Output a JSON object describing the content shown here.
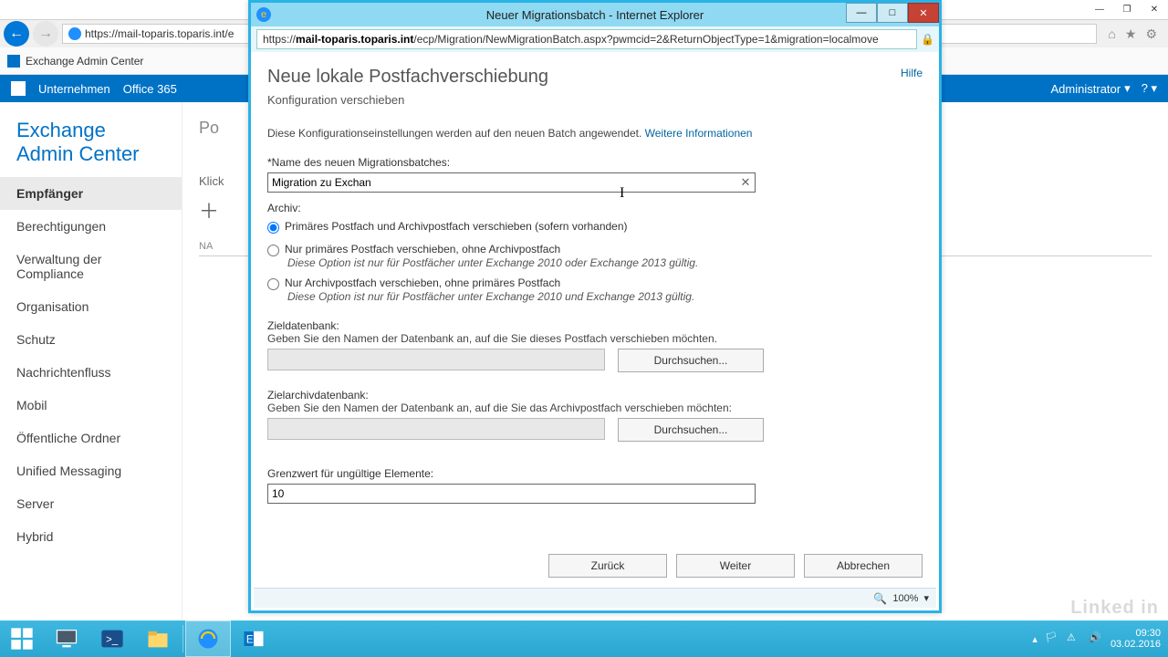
{
  "main_window": {
    "url": "https://mail-toparis.toparis.int/e",
    "tab_title": "Exchange Admin Center",
    "o365": {
      "company": "Unternehmen",
      "office": "Office 365",
      "admin": "Administrator",
      "help": "?"
    },
    "eac_title": "Exchange Admin Center",
    "nav": [
      "Empfänger",
      "Berechtigungen",
      "Verwaltung der Compliance",
      "Organisation",
      "Schutz",
      "Nachrichtenfluss",
      "Mobil",
      "Öffentliche Ordner",
      "Unified Messaging",
      "Server",
      "Hybrid"
    ],
    "content": {
      "heading_partial": "Po",
      "klick_partial": "Klick",
      "nah_partial": "NA"
    }
  },
  "popup": {
    "title": "Neuer Migrationsbatch - Internet Explorer",
    "url_prefix": "https://",
    "url_host": "mail-toparis.toparis.int",
    "url_path": "/ecp/Migration/NewMigrationBatch.aspx?pwmcid=2&ReturnObjectType=1&migration=localmove",
    "help": "Hilfe",
    "h1": "Neue lokale Postfachverschiebung",
    "h2": "Konfiguration verschieben",
    "desc": "Diese Konfigurationseinstellungen werden auf den neuen Batch angewendet.",
    "more_info": "Weitere Informationen",
    "name_label": "*Name des neuen Migrationsbatches:",
    "name_value": "Migration zu Exchan",
    "archive_label": "Archiv:",
    "radios": {
      "r1": "Primäres Postfach und Archivpostfach verschieben (sofern vorhanden)",
      "r2": "Nur primäres Postfach verschieben, ohne Archivpostfach",
      "r2_note": "Diese Option ist nur für Postfächer unter Exchange 2010 oder Exchange 2013 gültig.",
      "r3": "Nur Archivpostfach verschieben, ohne primäres Postfach",
      "r3_note": "Diese Option ist nur für Postfächer unter Exchange 2010 und Exchange 2013 gültig."
    },
    "targetdb_label": "Zieldatenbank:",
    "targetdb_hint": "Geben Sie den Namen der Datenbank an, auf die Sie dieses Postfach verschieben möchten.",
    "archivedb_label": "Zielarchivdatenbank:",
    "archivedb_hint": "Geben Sie den Namen der Datenbank an, auf die Sie das Archivpostfach verschieben möchten:",
    "browse": "Durchsuchen...",
    "baditems_label": "Grenzwert für ungültige Elemente:",
    "baditems_value": "10",
    "btn_back": "Zurück",
    "btn_next": "Weiter",
    "btn_cancel": "Abbrechen",
    "zoom": "100%"
  },
  "taskbar": {
    "time": "09:30",
    "date": "03.02.2016"
  },
  "watermark": "Linked in"
}
